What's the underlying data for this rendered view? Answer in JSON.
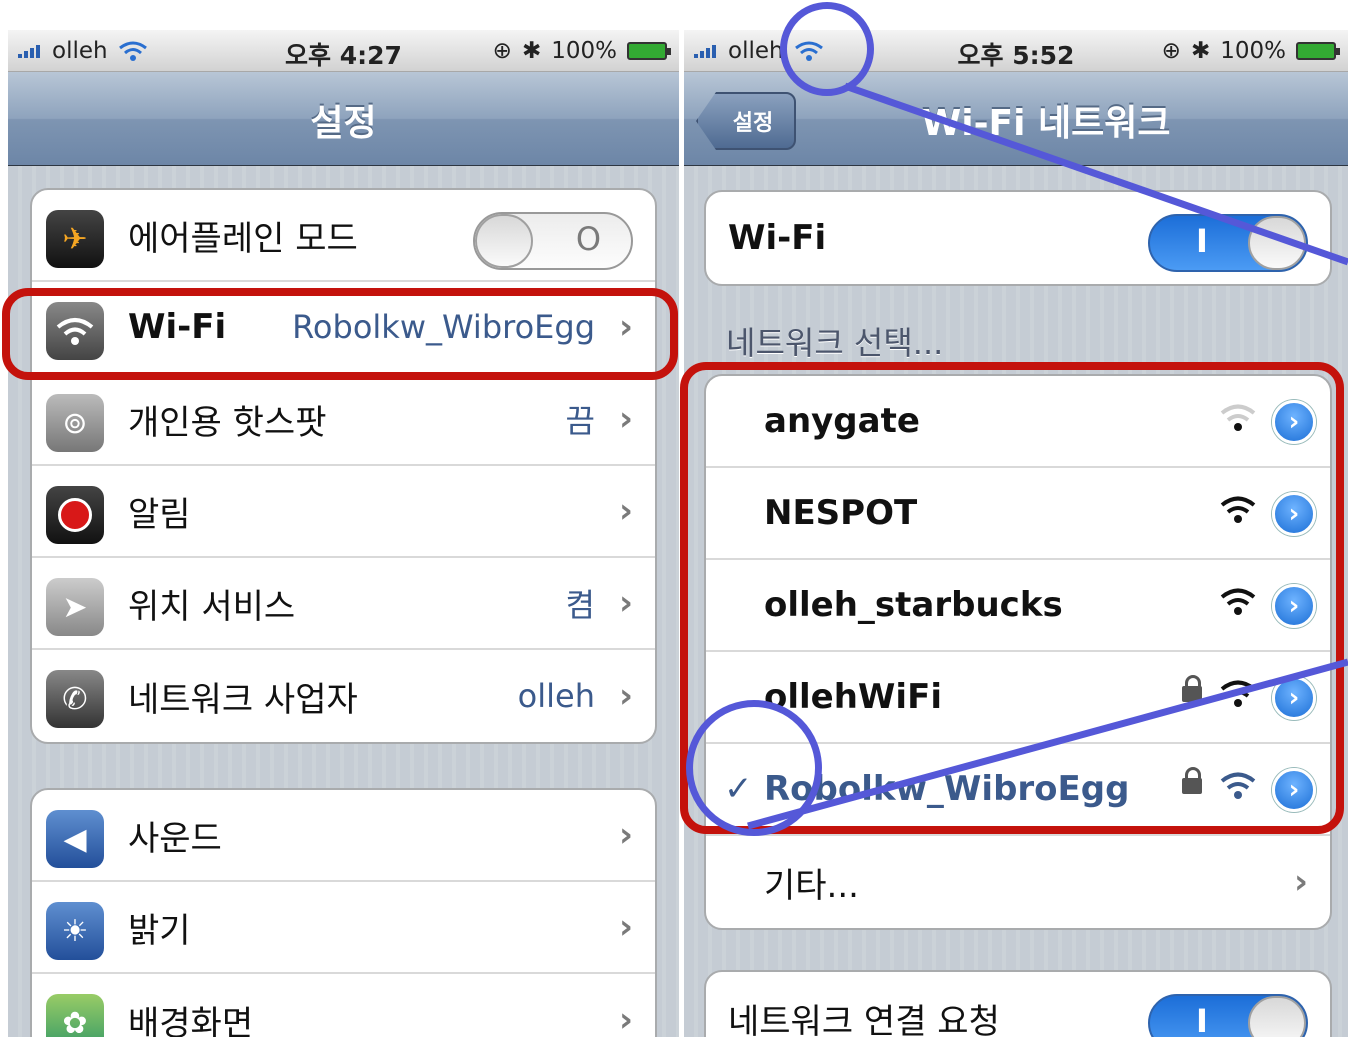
{
  "left": {
    "status": {
      "carrier": "olleh",
      "time": "오후 4:27",
      "battery": "100%"
    },
    "nav_title": "설정",
    "group1": [
      {
        "label": "에어플레인 모드",
        "toggle": "O",
        "icon": "airplane-icon"
      },
      {
        "label": "Wi-Fi",
        "value": "Robolkw_WibroEgg",
        "icon": "wifi-icon"
      },
      {
        "label": "개인용 핫스팟",
        "value": "끔",
        "icon": "hotspot-icon"
      },
      {
        "label": "알림",
        "value": "",
        "icon": "notification-icon"
      },
      {
        "label": "위치 서비스",
        "value": "켬",
        "icon": "location-icon"
      },
      {
        "label": "네트워크 사업자",
        "value": "olleh",
        "icon": "phone-icon"
      }
    ],
    "group2": [
      {
        "label": "사운드",
        "icon": "sound-icon"
      },
      {
        "label": "밝기",
        "icon": "brightness-icon"
      },
      {
        "label": "배경화면",
        "icon": "wallpaper-icon"
      }
    ]
  },
  "right": {
    "status": {
      "carrier": "olleh",
      "time": "오후 5:52",
      "battery": "100%"
    },
    "back_label": "설정",
    "nav_title": "Wi-Fi 네트워크",
    "wifi_label": "Wi-Fi",
    "wifi_toggle": "I",
    "section_label": "네트워크 선택...",
    "networks": [
      {
        "name": "anygate",
        "locked": false,
        "selected": false,
        "signal": 1
      },
      {
        "name": "NESPOT",
        "locked": false,
        "selected": false,
        "signal": 3
      },
      {
        "name": "olleh_starbucks",
        "locked": false,
        "selected": false,
        "signal": 3
      },
      {
        "name": "ollehWiFi",
        "locked": true,
        "selected": false,
        "signal": 3
      },
      {
        "name": "Robolkw_WibroEgg",
        "locked": true,
        "selected": true,
        "signal": 3
      }
    ],
    "check": "✓",
    "other_label": "기타...",
    "ask_label": "네트워크 연결 요청",
    "ask_toggle": "I"
  },
  "colors": {
    "annotation_red": "#c4120c",
    "annotation_blue": "#5558d8",
    "ios_blue": "#3b5a8c"
  }
}
